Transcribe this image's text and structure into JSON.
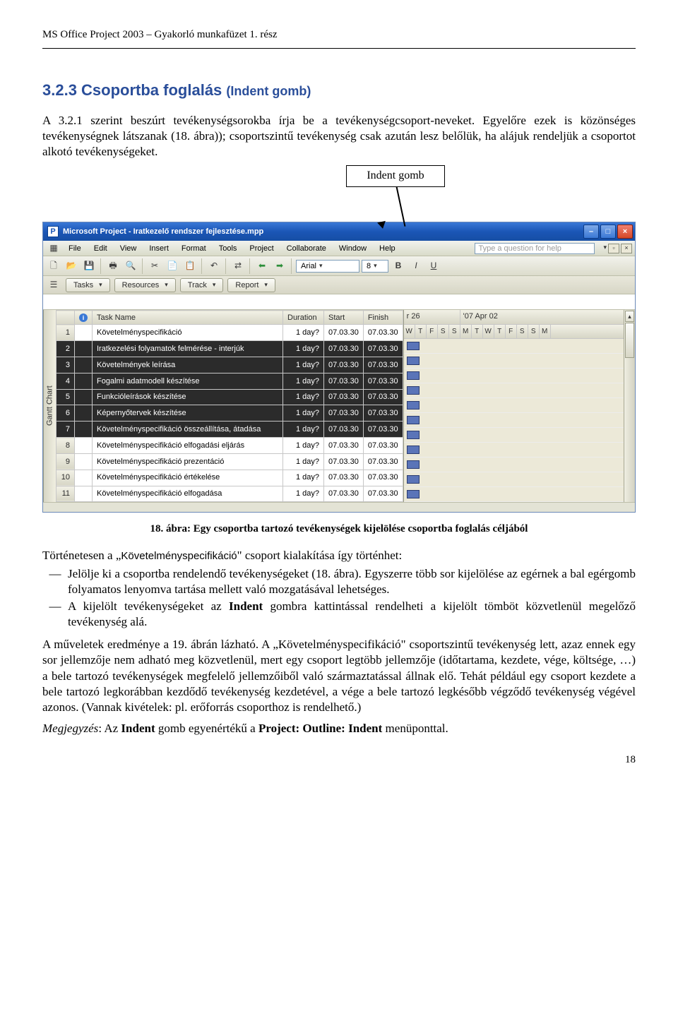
{
  "header": "MS Office Project 2003 – Gyakorló munkafüzet 1. rész",
  "section_title_main": "3.2.3 Csoportba foglalás ",
  "section_title_paren": "(Indent gomb)",
  "para1": "A 3.2.1 szerint beszúrt tevékenységsorokba írja be a tevékenységcsoport-neveket. Egyelőre ezek is közönséges tevékenységnek látszanak (18. ábra)); csoportszintű tevékenység csak azután lesz belőlük, ha alájuk rendeljük a csoportot alkotó tevékenységeket.",
  "callout": "Indent gomb",
  "app": {
    "title": "Microsoft Project - Iratkezelő rendszer fejlesztése.mpp",
    "menus": [
      "File",
      "Edit",
      "View",
      "Insert",
      "Format",
      "Tools",
      "Project",
      "Collaborate",
      "Window",
      "Help"
    ],
    "qhelp_placeholder": "Type a question for help",
    "font_name": "Arial",
    "font_size": "8",
    "viewbar": [
      "Tasks",
      "Resources",
      "Track",
      "Report"
    ],
    "columns": [
      "",
      "",
      "Task Name",
      "Duration",
      "Start",
      "Finish"
    ],
    "timescale_group1": "r 26",
    "timescale_group2": "'07 Apr 02",
    "timescale_days": [
      "W",
      "T",
      "F",
      "S",
      "S",
      "M",
      "T",
      "W",
      "T",
      "F",
      "S",
      "S",
      "M"
    ],
    "gantt_label": "Gantt Chart",
    "rows": [
      {
        "n": 1,
        "sel": false,
        "name": "Követelményspecifikáció",
        "dur": "1 day?",
        "start": "07.03.30",
        "fin": "07.03.30"
      },
      {
        "n": 2,
        "sel": true,
        "name": "Iratkezelési folyamatok felmérése - interjúk",
        "dur": "1 day?",
        "start": "07.03.30",
        "fin": "07.03.30"
      },
      {
        "n": 3,
        "sel": true,
        "name": "Követelmények leírása",
        "dur": "1 day?",
        "start": "07.03.30",
        "fin": "07.03.30"
      },
      {
        "n": 4,
        "sel": true,
        "name": "Fogalmi adatmodell készítése",
        "dur": "1 day?",
        "start": "07.03.30",
        "fin": "07.03.30"
      },
      {
        "n": 5,
        "sel": true,
        "name": "Funkcióleírások készítése",
        "dur": "1 day?",
        "start": "07.03.30",
        "fin": "07.03.30"
      },
      {
        "n": 6,
        "sel": true,
        "name": "Képernyőtervek készítése",
        "dur": "1 day?",
        "start": "07.03.30",
        "fin": "07.03.30"
      },
      {
        "n": 7,
        "sel": true,
        "name": "Követelményspecifikáció összeállítása, átadása",
        "dur": "1 day?",
        "start": "07.03.30",
        "fin": "07.03.30"
      },
      {
        "n": 8,
        "sel": false,
        "name": "Követelményspecifikáció elfogadási eljárás",
        "dur": "1 day?",
        "start": "07.03.30",
        "fin": "07.03.30"
      },
      {
        "n": 9,
        "sel": false,
        "name": "Követelményspecifikáció prezentáció",
        "dur": "1 day?",
        "start": "07.03.30",
        "fin": "07.03.30"
      },
      {
        "n": 10,
        "sel": false,
        "name": "Követelményspecifikáció értékelése",
        "dur": "1 day?",
        "start": "07.03.30",
        "fin": "07.03.30"
      },
      {
        "n": 11,
        "sel": false,
        "name": "Követelményspecifikáció elfogadása",
        "dur": "1 day?",
        "start": "07.03.30",
        "fin": "07.03.30"
      }
    ]
  },
  "caption": "18. ábra: Egy csoportba tartozó tevékenységek kijelölése csoportba foglalás céljából",
  "para2_a": "Történetesen a „",
  "para2_group": "Követelményspecifikáció",
  "para2_b": "\" csoport kialakítása így történhet:",
  "bullet1": "Jelölje ki a csoportba rendelendő tevékenységeket (18. ábra). Egyszerre több sor kijelölése az egérnek a bal egérgomb folyamatos lenyomva tartása mellett való mozgatásával lehetséges.",
  "bullet2_a": "A kijelölt tevékenységeket az ",
  "bullet2_bold": "Indent",
  "bullet2_b": " gombra kattintással rendelheti a kijelölt tömböt közvetlenül megelőző tevékenység alá.",
  "para3": "A műveletek eredménye a 19. ábrán lázható. A „Követelményspecifikáció\" csoportszintű tevékenység lett, azaz ennek egy sor jellemzője nem adható meg közvetlenül, mert egy csoport legtöbb jellemzője (időtartama, kezdete, vége, költsége, …) a bele tartozó tevékenységek megfelelő jellemzőiből való származtatással állnak elő. Tehát például egy csoport kezdete a bele tartozó legkorábban kezdődő tevékenység kezdetével, a vége a bele tartozó legkésőbb végződő tevékenység végével azonos. (Vannak kivételek: pl. erőforrás csoporthoz is rendelhető.)",
  "para4_a": "Megjegyzés",
  "para4_b": ": Az ",
  "para4_c": "Indent",
  "para4_d": " gomb egyenértékű a ",
  "para4_e": "Project: Outline: Indent",
  "para4_f": " menüponttal.",
  "pagenum": "18"
}
